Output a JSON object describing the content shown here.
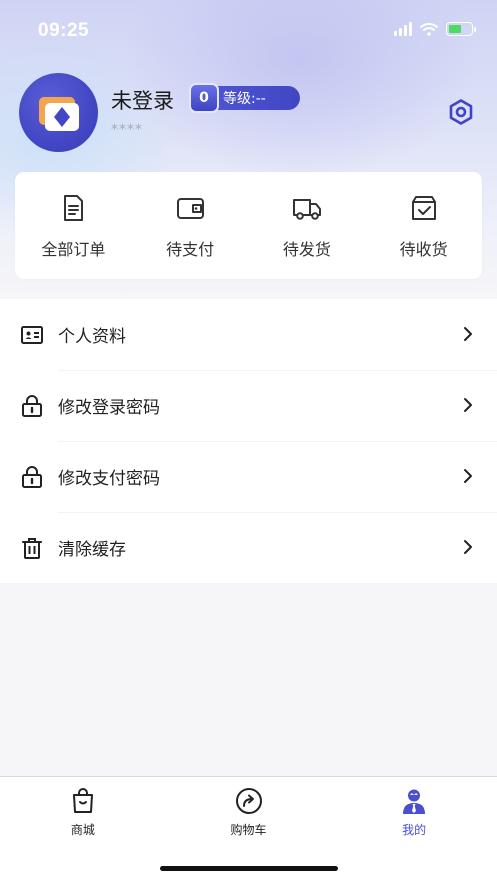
{
  "status_bar": {
    "time": "09:25"
  },
  "profile": {
    "username": "未登录",
    "level_number": "0",
    "level_text": "等级:--",
    "sub_text": "****"
  },
  "orders": [
    {
      "label": "全部订单",
      "icon": "order-list-icon"
    },
    {
      "label": "待支付",
      "icon": "wallet-icon"
    },
    {
      "label": "待发货",
      "icon": "truck-icon"
    },
    {
      "label": "待收货",
      "icon": "box-check-icon"
    }
  ],
  "menu": [
    {
      "label": "个人资料",
      "icon": "id-card-icon"
    },
    {
      "label": "修改登录密码",
      "icon": "lock-icon"
    },
    {
      "label": "修改支付密码",
      "icon": "lock-icon"
    },
    {
      "label": "清除缓存",
      "icon": "trash-icon"
    }
  ],
  "tabbar": [
    {
      "label": "商城",
      "icon": "shopping-bag-icon",
      "active": false
    },
    {
      "label": "购物车",
      "icon": "share-circle-icon",
      "active": false
    },
    {
      "label": "我的",
      "icon": "user-icon",
      "active": true
    }
  ],
  "colors": {
    "accent": "#4a4fcf",
    "text": "#222222",
    "subtext": "#a7a9b5",
    "background": "#f6f6f8"
  }
}
